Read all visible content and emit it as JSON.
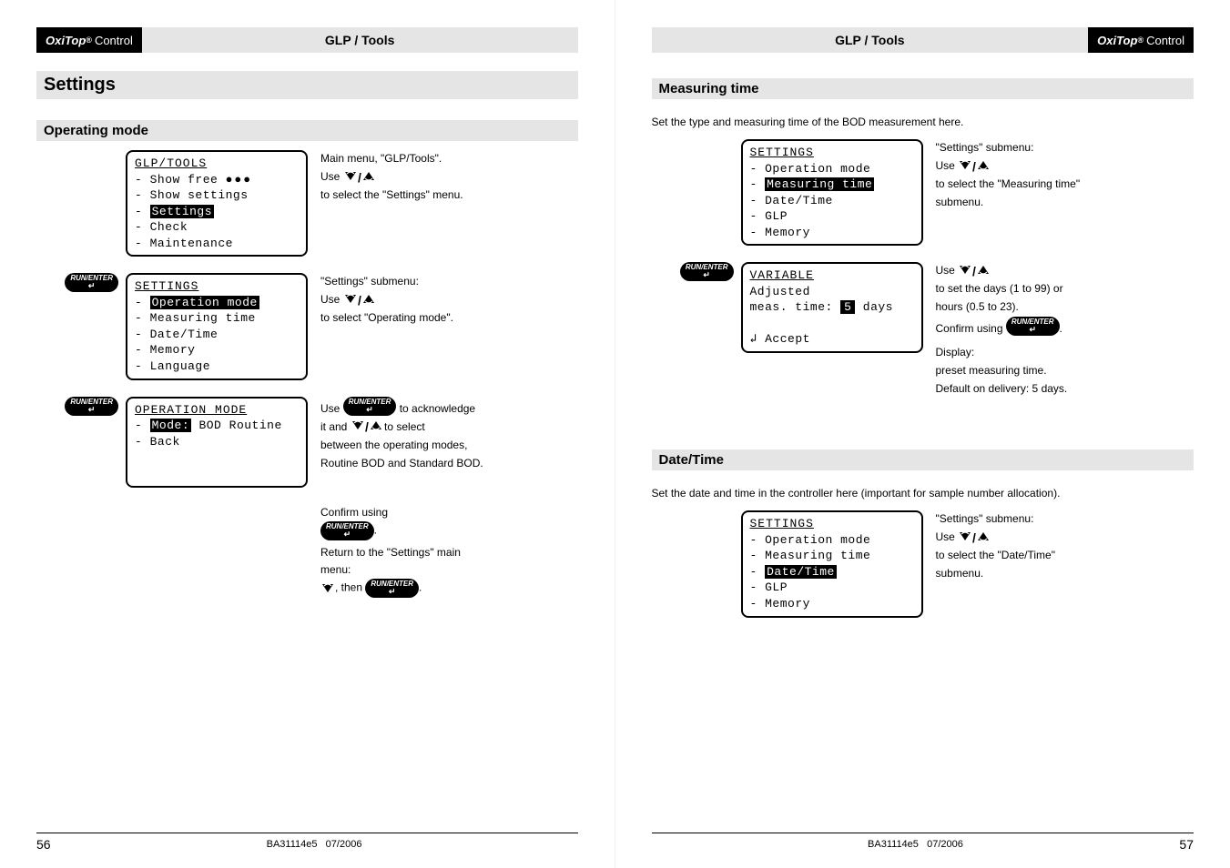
{
  "brand": {
    "name": "OxiTop",
    "suffix": "Control"
  },
  "chapter": "GLP / Tools",
  "left": {
    "section": "Settings",
    "subsection": "Operating mode",
    "step1": {
      "lcd_title": "GLP/TOOLS",
      "items": [
        "Show free ●●●",
        "Show settings",
        "Settings",
        "Check",
        "Maintenance"
      ],
      "highlight_index": 2,
      "text1": "Main menu, \"GLP/Tools\".",
      "use": "Use ",
      "text2": "to select the \"Settings\" menu."
    },
    "step2": {
      "lcd_title": "SETTINGS",
      "items": [
        "Operation mode",
        "Measuring time",
        "Date/Time",
        "Memory",
        "Language"
      ],
      "highlight_index": 0,
      "text1": "\"Settings\" submenu:",
      "use": "Use ",
      "text2": "to select \"Operating mode\"."
    },
    "step3": {
      "lcd_title": "OPERATION MODE",
      "mode_label": "Mode:",
      "mode_value": "BOD Routine",
      "back": "Back",
      "text_use": "Use ",
      "text_ack": " to acknowledge",
      "text_itand": "it and ",
      "text_sel": " to select",
      "text_between": "between the operating modes,",
      "text_routine": "Routine BOD and Standard BOD.",
      "confirm": "Confirm using",
      "return1": "Return to the \"Settings\" main",
      "return2": "menu:",
      "then": ", then "
    }
  },
  "right": {
    "measuring": {
      "title": "Measuring time",
      "intro": "Set the type and measuring time of the BOD measurement here.",
      "step1": {
        "lcd_title": "SETTINGS",
        "items": [
          "Operation mode",
          "Measuring time",
          "Date/Time",
          "GLP",
          "Memory"
        ],
        "highlight_index": 1,
        "text1": "\"Settings\" submenu:",
        "use": "Use ",
        "text2": "to select the \"Measuring time\"",
        "text3": "submenu."
      },
      "step2": {
        "lcd_title": "VARIABLE",
        "line1": "Adjusted",
        "line2_a": "meas. time:",
        "line2_val": "5",
        "line2_unit": "days",
        "accept": "↲ Accept",
        "use": "Use ",
        "text_set": "to set the days (1 to 99) or",
        "text_hours": "hours (0.5 to 23).",
        "confirm": "Confirm using ",
        "display": "Display:",
        "preset": "preset measuring time.",
        "default": "Default on delivery: 5 days."
      }
    },
    "datetime": {
      "title": "Date/Time",
      "intro": "Set the date and time in the controller here (important for sample number allocation).",
      "step1": {
        "lcd_title": "SETTINGS",
        "items": [
          "Operation mode",
          "Measuring time",
          "Date/Time",
          "GLP",
          "Memory"
        ],
        "highlight_index": 2,
        "text1": "\"Settings\" submenu:",
        "use": "Use ",
        "text2": "to select the \"Date/Time\"",
        "text3": "submenu."
      }
    }
  },
  "footer": {
    "doc": "BA31114e5",
    "date": "07/2006",
    "left_page": "56",
    "right_page": "57"
  }
}
